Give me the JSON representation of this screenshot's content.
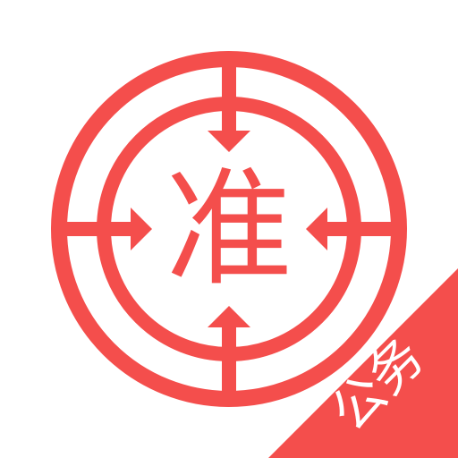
{
  "icon": {
    "main_char": "准",
    "ribbon_label": "公务",
    "accent_color": "#F44E4C",
    "background_color": "#FFFFFF",
    "symbol_name": "crosshair-target-icon"
  }
}
